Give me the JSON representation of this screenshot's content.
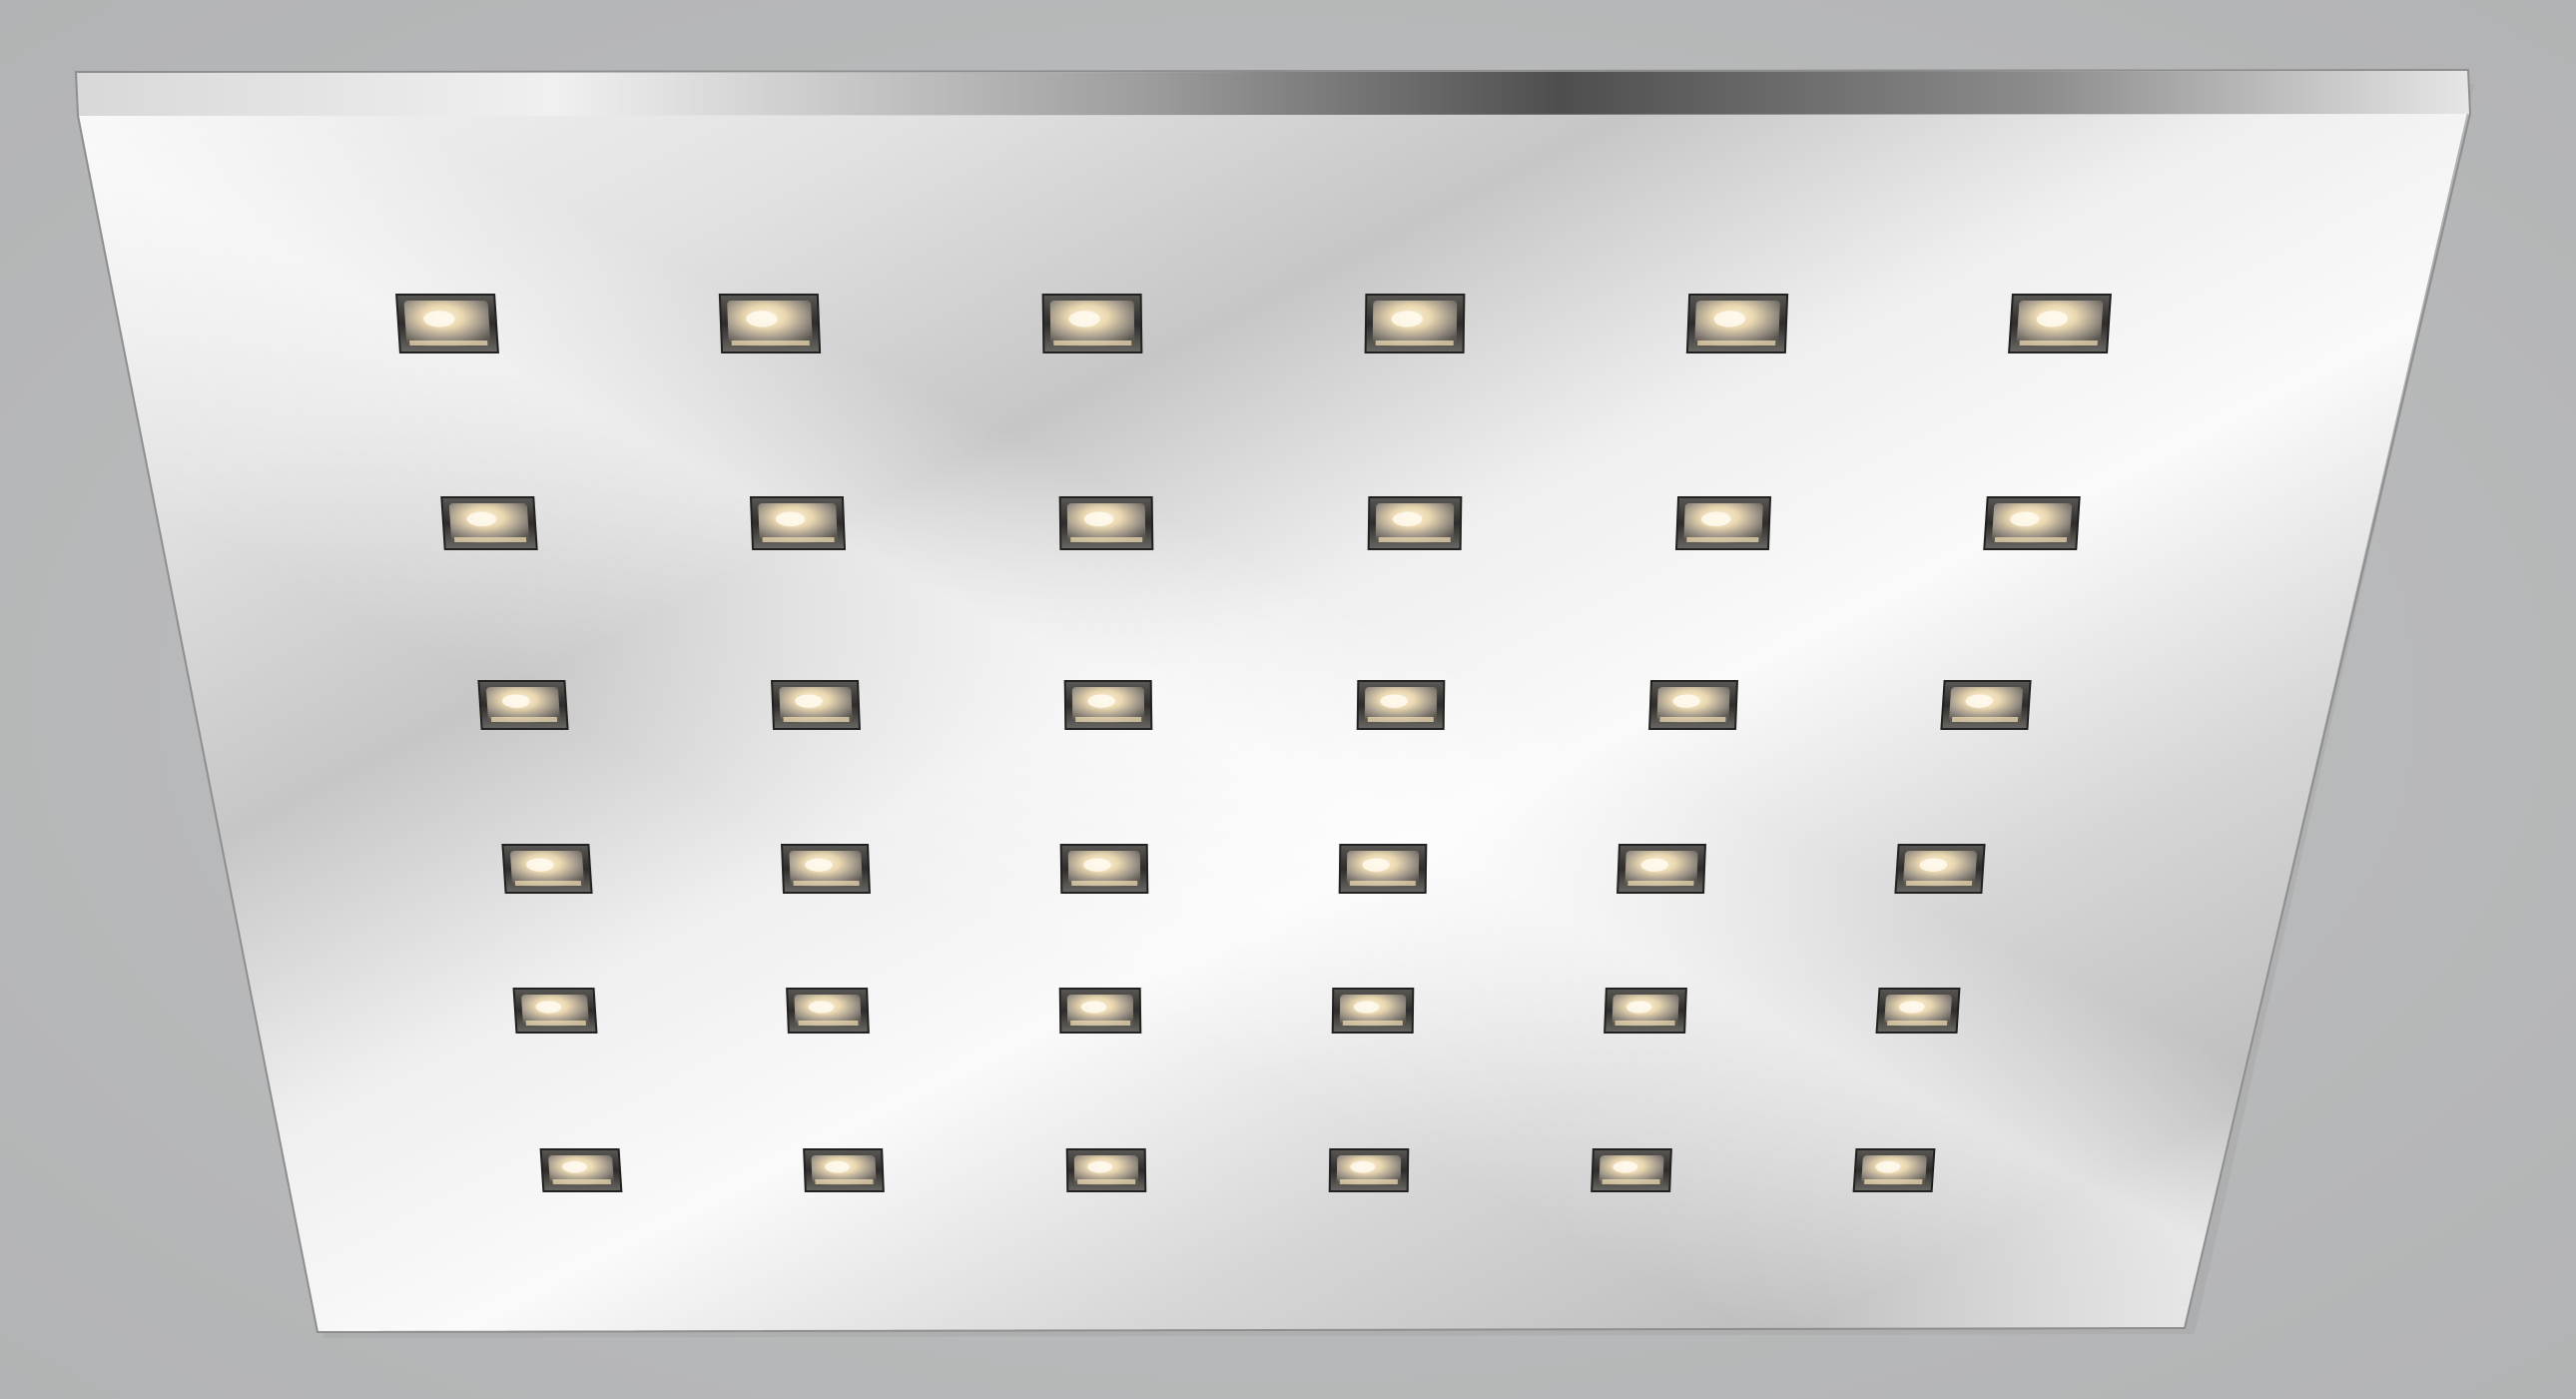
{
  "image": {
    "subject": "square-led-ceiling-panel",
    "finish": "polished-chrome",
    "grid": {
      "rows": 6,
      "columns": 6
    },
    "colors": {
      "background": "#b9babb",
      "panel_face_light": "#f2f2f2",
      "panel_face_dark": "#aeaeae",
      "top_edge_dark": "#5c5c5c",
      "led_warm": "#f5e2b8",
      "led_frame": "#3a3836"
    }
  }
}
